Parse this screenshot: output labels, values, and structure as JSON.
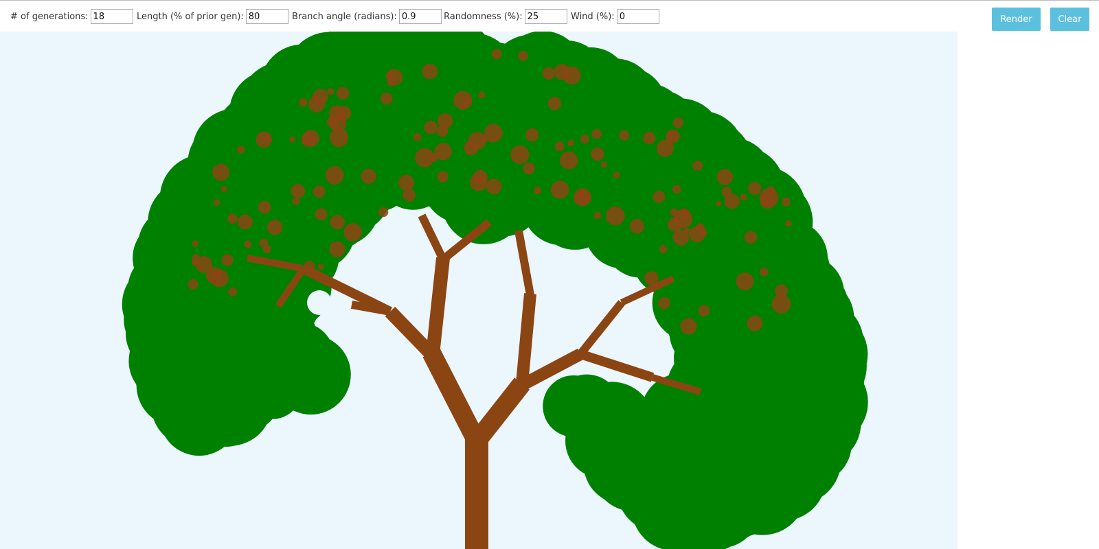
{
  "controls": {
    "generations": {
      "label": "# of generations:",
      "value": "18"
    },
    "length": {
      "label": "Length (% of prior gen):",
      "value": "80"
    },
    "angle": {
      "label": "Branch angle (radians):",
      "value": "0.9"
    },
    "randomness": {
      "label": "Randomness (%):",
      "value": "25"
    },
    "wind": {
      "label": "Wind (%):",
      "value": "0"
    }
  },
  "buttons": {
    "render": "Render",
    "clear": "Clear"
  },
  "colors": {
    "canvas_background": "#ecf6fd",
    "trunk": "#8b4513",
    "foliage": "#008000",
    "button": "#5bc0de"
  }
}
